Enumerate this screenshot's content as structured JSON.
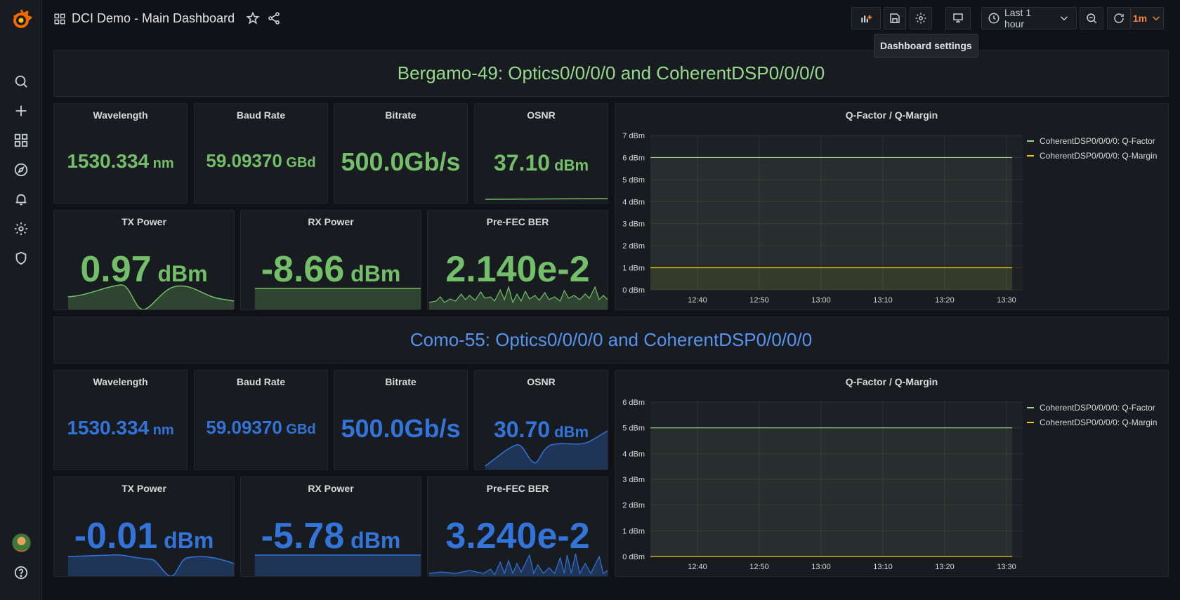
{
  "topbar": {
    "title": "DCI Demo - Main Dashboard",
    "time_range": "Last 1 hour",
    "refresh_interval": "1m",
    "tooltip": "Dashboard settings"
  },
  "colors": {
    "green": "#73bf69",
    "blue": "#3274d9",
    "row_green": "#96d98d",
    "row_blue": "#5794f2",
    "qfactor_line": "#96d98d",
    "qmargin_line": "#f2cc0c"
  },
  "sections": [
    {
      "row_title": "Bergamo-49: Optics0/0/0/0 and CoherentDSP0/0/0/0",
      "stats": {
        "wavelength": {
          "title": "Wavelength",
          "value": "1530.334",
          "unit": "nm"
        },
        "baud": {
          "title": "Baud Rate",
          "value": "59.09370",
          "unit": "GBd"
        },
        "bitrate": {
          "title": "Bitrate",
          "value": "500.0Gb/s",
          "unit": ""
        },
        "osnr": {
          "title": "OSNR",
          "value": "37.10",
          "unit": "dBm"
        },
        "tx": {
          "title": "TX Power",
          "value": "0.97",
          "unit": "dBm"
        },
        "rx": {
          "title": "RX Power",
          "value": "-8.66",
          "unit": "dBm"
        },
        "ber": {
          "title": "Pre-FEC BER",
          "value": "2.140e-2",
          "unit": ""
        }
      },
      "graph": {
        "title": "Q-Factor / Q-Margin",
        "legend": [
          "CoherentDSP0/0/0/0: Q-Factor",
          "CoherentDSP0/0/0/0: Q-Margin"
        ],
        "y_ticks": [
          "0 dBm",
          "1 dBm",
          "2 dBm",
          "3 dBm",
          "4 dBm",
          "5 dBm",
          "6 dBm",
          "7 dBm"
        ],
        "x_ticks": [
          "12:40",
          "12:50",
          "13:00",
          "13:10",
          "13:20",
          "13:30"
        ]
      }
    },
    {
      "row_title": "Como-55: Optics0/0/0/0 and CoherentDSP0/0/0/0",
      "stats": {
        "wavelength": {
          "title": "Wavelength",
          "value": "1530.334",
          "unit": "nm"
        },
        "baud": {
          "title": "Baud Rate",
          "value": "59.09370",
          "unit": "GBd"
        },
        "bitrate": {
          "title": "Bitrate",
          "value": "500.0Gb/s",
          "unit": ""
        },
        "osnr": {
          "title": "OSNR",
          "value": "30.70",
          "unit": "dBm"
        },
        "tx": {
          "title": "TX Power",
          "value": "-0.01",
          "unit": "dBm"
        },
        "rx": {
          "title": "RX Power",
          "value": "-5.78",
          "unit": "dBm"
        },
        "ber": {
          "title": "Pre-FEC BER",
          "value": "3.240e-2",
          "unit": ""
        }
      },
      "graph": {
        "title": "Q-Factor / Q-Margin",
        "legend": [
          "CoherentDSP0/0/0/0: Q-Factor",
          "CoherentDSP0/0/0/0: Q-Margin"
        ],
        "y_ticks": [
          "0 dBm",
          "1 dBm",
          "2 dBm",
          "3 dBm",
          "4 dBm",
          "5 dBm",
          "6 dBm"
        ],
        "x_ticks": [
          "12:40",
          "12:50",
          "13:00",
          "13:10",
          "13:20",
          "13:30"
        ]
      }
    }
  ],
  "chart_data": [
    {
      "type": "line",
      "title": "Q-Factor / Q-Margin",
      "ylim": [
        0,
        7
      ],
      "x": [
        "12:40",
        "12:50",
        "13:00",
        "13:10",
        "13:20",
        "13:30"
      ],
      "series": [
        {
          "name": "CoherentDSP0/0/0/0: Q-Factor",
          "values": [
            6,
            6,
            6,
            6,
            6,
            6
          ]
        },
        {
          "name": "CoherentDSP0/0/0/0: Q-Margin",
          "values": [
            1,
            1,
            1,
            1,
            1,
            1
          ]
        }
      ]
    },
    {
      "type": "line",
      "title": "Q-Factor / Q-Margin",
      "ylim": [
        0,
        6
      ],
      "x": [
        "12:40",
        "12:50",
        "13:00",
        "13:10",
        "13:20",
        "13:30"
      ],
      "series": [
        {
          "name": "CoherentDSP0/0/0/0: Q-Factor",
          "values": [
            5,
            5,
            5,
            5,
            5,
            5
          ]
        },
        {
          "name": "CoherentDSP0/0/0/0: Q-Margin",
          "values": [
            0,
            0,
            0,
            0,
            0,
            0
          ]
        }
      ]
    }
  ]
}
